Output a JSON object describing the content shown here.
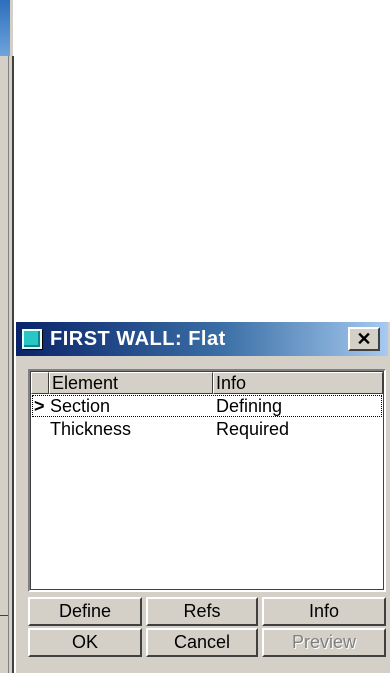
{
  "dialog": {
    "title": "FIRST WALL: Flat",
    "close_label": "✕"
  },
  "list": {
    "columns": [
      "Element",
      "Info"
    ],
    "rows": [
      {
        "marker": ">",
        "element": "Section",
        "info": "Defining",
        "selected": true
      },
      {
        "marker": "",
        "element": "Thickness",
        "info": "Required",
        "selected": false
      }
    ]
  },
  "buttons": {
    "define": "Define",
    "refs": "Refs",
    "info": "Info",
    "ok": "OK",
    "cancel": "Cancel",
    "preview": "Preview"
  },
  "colors": {
    "face": "#d4d0c8",
    "title_active": "#0a246a",
    "title_gradient_end": "#a6caf0",
    "icon_teal": "#29c6c6",
    "disabled_text": "#808080"
  },
  "icons": {
    "app": "teal-window-icon",
    "close": "close-icon",
    "row_marker": "chevron-right-icon"
  }
}
